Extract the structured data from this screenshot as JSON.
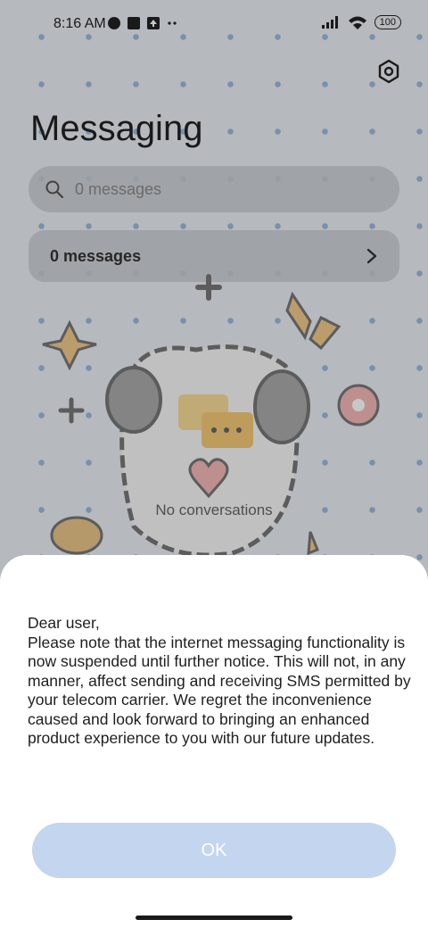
{
  "status_bar": {
    "time": "8:16 AM",
    "battery": "100"
  },
  "header": {
    "title": "Messaging"
  },
  "search": {
    "placeholder": "0 messages"
  },
  "messages_row": {
    "label": "0 messages"
  },
  "empty_state": {
    "text": "No conversations"
  },
  "dialog": {
    "text": "Dear user,\nPlease note that the internet messaging functionality is now suspended until further notice. This will not, in any manner, affect sending and receiving SMS permitted by your telecom carrier. We regret the inconvenience caused and look forward to bringing an enhanced product experience to you with our future updates.",
    "ok_label": "OK"
  },
  "colors": {
    "ok_button": "#c4d5ef",
    "dot_pattern": "#8fb0d8"
  }
}
